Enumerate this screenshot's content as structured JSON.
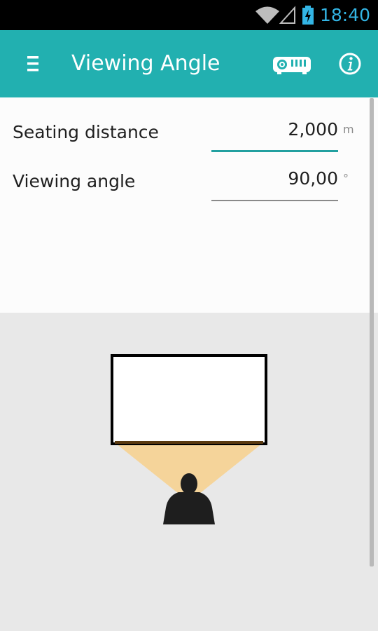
{
  "status_bar": {
    "time": "18:40",
    "accent_color": "#33b5e5",
    "icons": [
      "wifi-icon",
      "cellular-signal-icon",
      "battery-charging-icon"
    ]
  },
  "action_bar": {
    "title": "Viewing Angle",
    "background_color": "#22b0b0",
    "icons": [
      "menu-icon",
      "projector-icon",
      "info-icon"
    ]
  },
  "form": {
    "seating_distance": {
      "label": "Seating distance",
      "value": "2,000",
      "unit": "m",
      "focused": true
    },
    "viewing_angle": {
      "label": "Viewing angle",
      "value": "90,00",
      "unit": "°",
      "focused": false
    }
  },
  "illustration": {
    "icons": [
      "screen-icon",
      "viewer-silhouette-icon"
    ],
    "viewing_cone_color": "#f5d49a"
  }
}
